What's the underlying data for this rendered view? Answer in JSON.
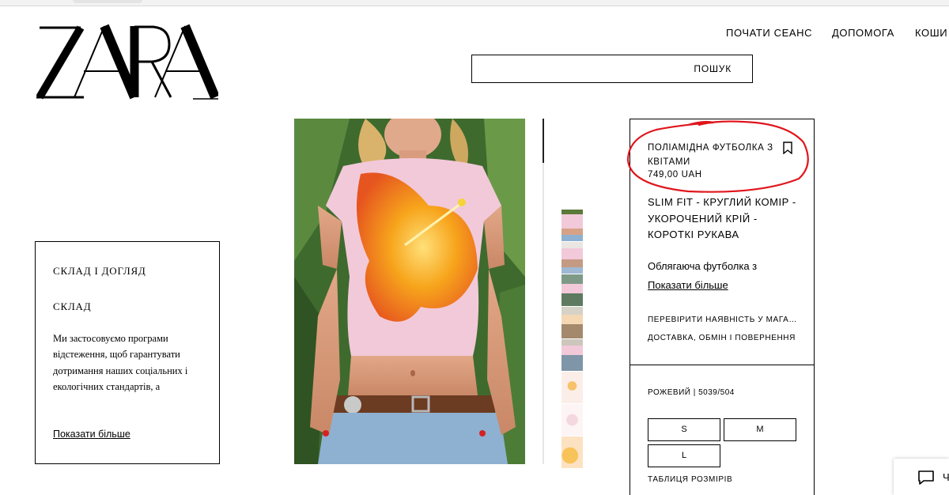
{
  "brand": {
    "logo": "ZARA"
  },
  "nav": {
    "login": "ПОЧАТИ СЕАНС",
    "help": "ДОПОМОГА",
    "cart": "КОШИ"
  },
  "search": {
    "label": "ПОШУК"
  },
  "care": {
    "heading": "СКЛАД І ДОГЛЯД",
    "subheading": "СКЛАД",
    "text": "Ми застосовуємо програми відстеження, щоб гарантувати дотримання наших соціальних і екологічних стандартів, а",
    "show_more": "Показати більше"
  },
  "product": {
    "title": "ПОЛІАМІДНА ФУТБОЛКА З КВІТАМИ",
    "price": "749,00 UAH",
    "fit": "SLIM FIT - КРУГЛИЙ КОМІР - УКОРОЧЕНИЙ КРІЙ - КОРОТКІ РУКАВА",
    "description": "Облягаюча футболка з",
    "show_more": "Показати більше",
    "check_store": "ПЕРЕВІРИТИ НАЯВНІСТЬ У МАГАЗИНАХ",
    "delivery": "ДОСТАВКА, ОБМІН І ПОВЕРНЕННЯ"
  },
  "sizes": {
    "color_label": "РОЖЕВИЙ | 5039/504",
    "options": [
      "S",
      "M",
      "L"
    ],
    "size_chart": "ТАБЛИЦЯ РОЗМІРІВ"
  },
  "chat": {
    "label": "Ч"
  },
  "colors": {
    "shirt": "#f2c9d9",
    "flower": "#f7a51c",
    "flower_edge": "#e6551f",
    "annotation": "#e0161d",
    "leaves": "#3f6a2e"
  },
  "icons": {
    "bookmark": "bookmark-icon",
    "chat": "chat-icon"
  }
}
